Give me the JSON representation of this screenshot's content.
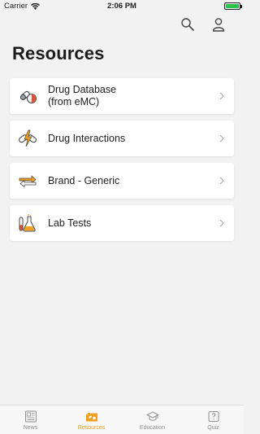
{
  "status_bar": {
    "carrier": "Carrier",
    "time": "2:06 PM"
  },
  "header": {
    "title": "Resources"
  },
  "resources": [
    {
      "label_line1": "Drug Database",
      "label_line2": "(from eMC)",
      "icon": "pill-capsule-icon"
    },
    {
      "label_line1": "Drug Interactions",
      "label_line2": "",
      "icon": "interaction-lightning-icon"
    },
    {
      "label_line1": "Brand - Generic",
      "label_line2": "",
      "icon": "swap-arrows-icon"
    },
    {
      "label_line1": "Lab Tests",
      "label_line2": "",
      "icon": "flask-icon"
    }
  ],
  "tabs": [
    {
      "label": "News",
      "icon": "newspaper-icon",
      "active": false
    },
    {
      "label": "Resources",
      "icon": "resources-icon",
      "active": true
    },
    {
      "label": "Education",
      "icon": "graduation-cap-icon",
      "active": false
    },
    {
      "label": "Quiz",
      "icon": "quiz-icon",
      "active": false
    }
  ],
  "colors": {
    "accent": "#f0a01f",
    "danger": "#e0533a",
    "background": "#f2f2f2"
  }
}
